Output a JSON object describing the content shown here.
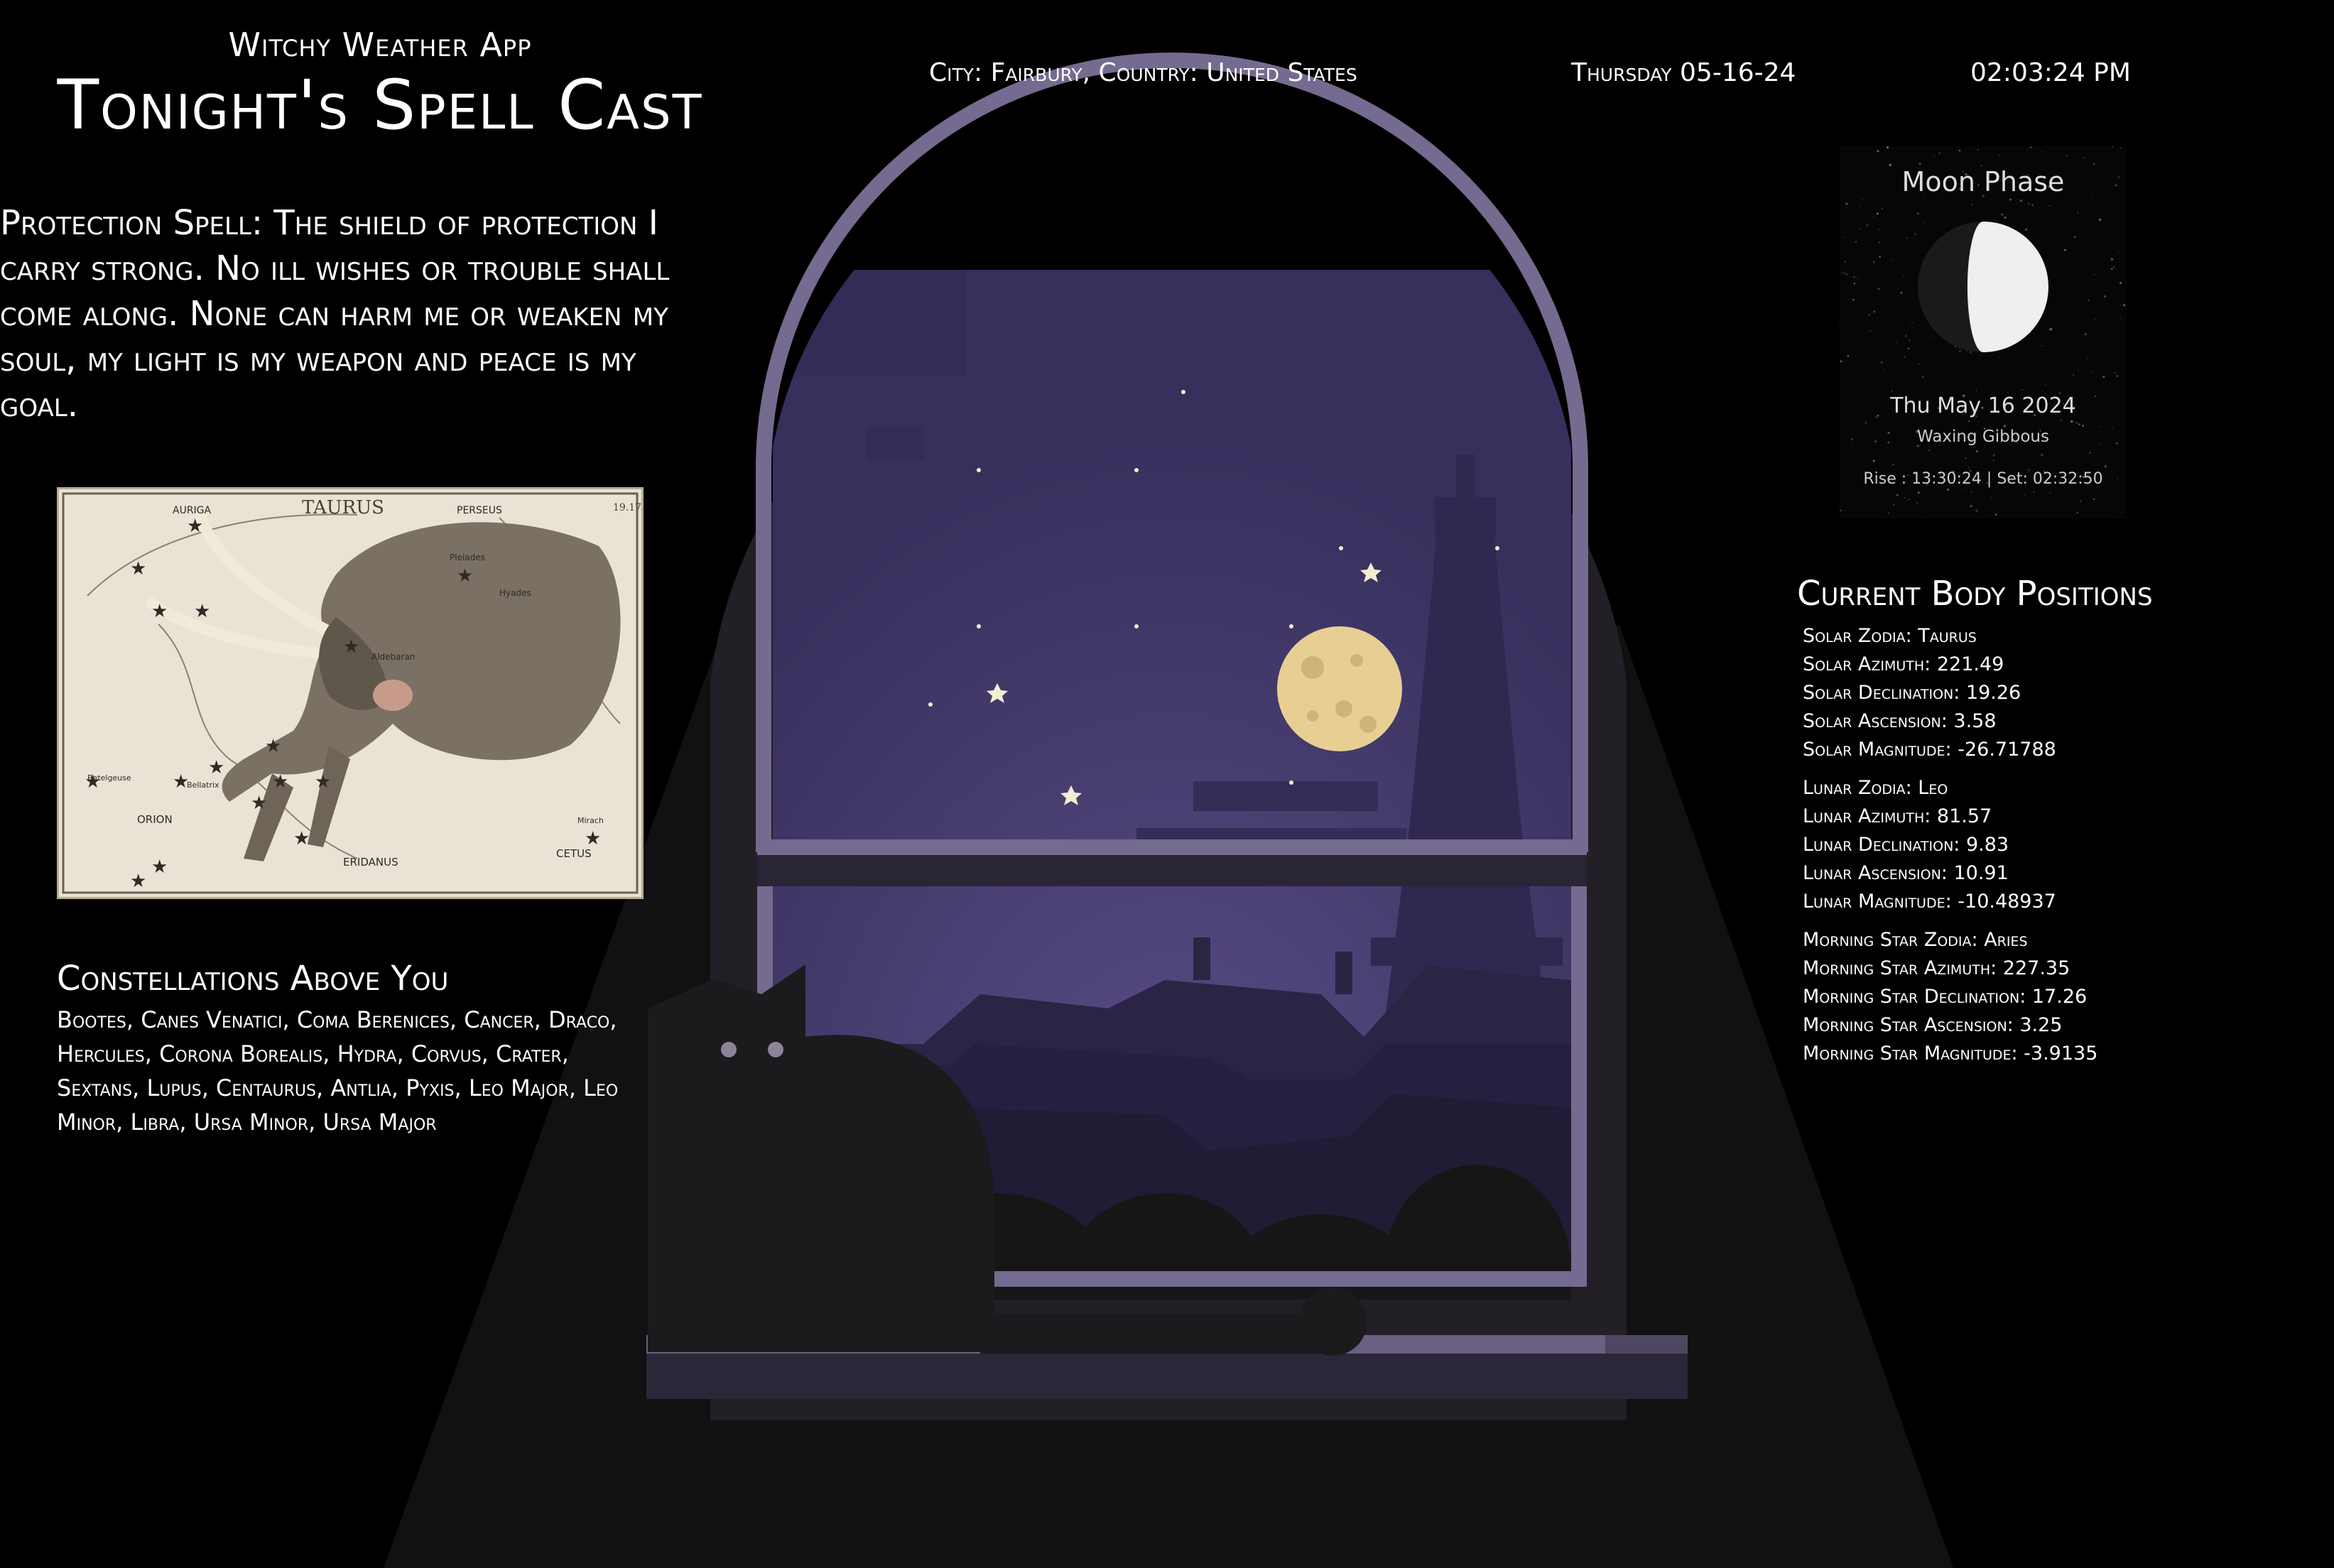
{
  "app": {
    "subtitle": "Witchy Weather App",
    "title": "Tonight's Spell Cast"
  },
  "header": {
    "location": "City: Fairbury, Country: United States",
    "date": "Thursday 05-16-24",
    "time": "02:03:24 PM"
  },
  "spell": {
    "text": "Protection Spell: The shield of protection I carry strong. No ill wishes or trouble shall come along. None can harm me or weaken my soul, my light is my weapon and peace is my goal."
  },
  "constellation_image": {
    "title": "TAURUS",
    "plate_number": "19.17",
    "labels": [
      "AURIGA",
      "PERSEUS",
      "ERIDANUS",
      "ORION",
      "CETUS",
      "Hyades",
      "Pleiades",
      "Aldebaran",
      "Bellatrix",
      "Betelgeuse",
      "Mirach"
    ]
  },
  "constellations": {
    "heading": "Constellations Above You",
    "list": "Bootes, Canes Venatici, Coma Berenices, Cancer, Draco, Hercules, Corona Borealis, Hydra, Corvus, Crater, Sextans, Lupus, Centaurus, Antlia, Pyxis, Leo Major, Leo Minor, Libra, Ursa Minor, Ursa Major"
  },
  "moon_phase": {
    "title": "Moon Phase",
    "date": "Thu May 16 2024",
    "phase": "Waxing Gibbous",
    "rise_set": "Rise : 13:30:24 | Set: 02:32:50",
    "illumination": 0.62
  },
  "body_positions": {
    "heading": "Current Body Positions",
    "solar": [
      "Solar Zodia: Taurus",
      "Solar Azimuth: 221.49",
      "Solar Declination: 19.26",
      "Solar Ascension: 3.58",
      "Solar Magnitude: -26.71788"
    ],
    "lunar": [
      "Lunar Zodia: Leo",
      "Lunar Azimuth: 81.57",
      "Lunar Declination: 9.83",
      "Lunar Ascension: 10.91",
      "Lunar Magnitude: -10.48937"
    ],
    "morning_star": [
      "Morning Star Zodia: Aries",
      "Morning Star Azimuth: 227.35",
      "Morning Star Declination: 17.26",
      "Morning Star Ascension: 3.25",
      "Morning Star Magnitude: -3.9135"
    ]
  },
  "colors": {
    "background": "#000000",
    "sky": "#3b3361",
    "window_frame": "#756a8f",
    "wall": "#232028",
    "moon": "#e7cf94",
    "cat": "#1b1b1d"
  }
}
